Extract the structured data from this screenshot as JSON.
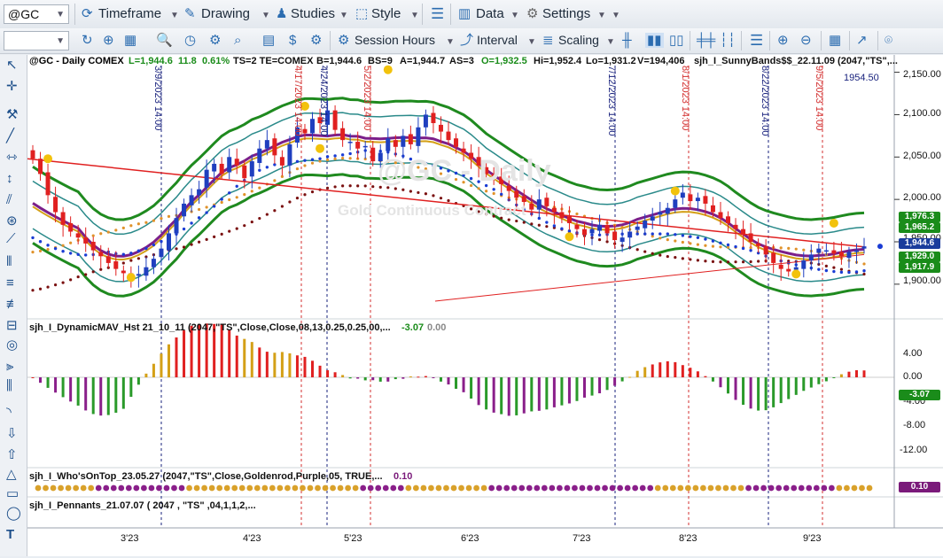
{
  "toolbar1": {
    "symbol": "@GC",
    "timeframe": "Timeframe",
    "drawing": "Drawing",
    "studies": "Studies",
    "style": "Style",
    "data": "Data",
    "settings": "Settings"
  },
  "toolbar2": {
    "session_hours": "Session Hours",
    "interval": "Interval",
    "scaling": "Scaling"
  },
  "chart_header": {
    "symbol_info": "@GC - Daily  COMEX",
    "last": "L=1,944.6",
    "change": "11.8",
    "change_pct": "0.61%",
    "ts_info": "TS=2  TE=COMEX",
    "bid": "B=1,944.6",
    "bs": "BS=9",
    "ask": "A=1,944.7",
    "as": "AS=3",
    "open": "O=1,932.5",
    "high": "Hi=1,952.4",
    "low": "Lo=1,931.2",
    "volume": "V=194,406",
    "study": "sjh_I_SunnyBands$$_22.11.09 (2047,\"TS\",...",
    "cursor_price": "1954.50"
  },
  "watermark": {
    "title": "@GC - Daily",
    "subtitle": "Gold Continuous Contract"
  },
  "panes": {
    "dynamic_mav": {
      "label": "sjh_I_DynamicMAV_Hst 21_10_11 (2047,\"TS\",Close,Close,08,13,0.25,0.25,00,...",
      "v1": "-3.07",
      "v2": "0.00"
    },
    "whos_on_top": {
      "label": "sjh_I_Who'sOnTop_23.05.27 (2047,\"TS\",Close,Goldenrod,Purple,05,  TRUE,...",
      "v1": "0.10"
    },
    "pennants": {
      "label": "sjh_I_Pennants_21.07.07 (  2047 ,  \"TS\" ,04,1,1,2,..."
    }
  },
  "price_axis": [
    "2,150.00",
    "2,100.00",
    "2,050.00",
    "2,000.00",
    "1,950.00",
    "1,900.00"
  ],
  "price_badges": [
    {
      "text": "1,976.3",
      "color": "#1a8c1a"
    },
    {
      "text": "1,965.2",
      "color": "#1a8c1a"
    },
    {
      "text": "1,944.6",
      "color": "#1a3c9c"
    },
    {
      "text": "1,929.0",
      "color": "#1a8c1a"
    },
    {
      "text": "1,917.9",
      "color": "#1a8c1a"
    }
  ],
  "mav_axis": [
    "4.00",
    "0.00",
    "-4.00",
    "-8.00",
    "-12.00"
  ],
  "mav_badge": {
    "text": "-3.07",
    "color": "#1a8c1a"
  },
  "wot_badge": {
    "text": "0.10",
    "color": "#7a1a7a"
  },
  "date_axis": [
    "3'23",
    "4'23",
    "5'23",
    "6'23",
    "7'23",
    "8'23",
    "9'23"
  ],
  "event_lines": [
    {
      "label": "3/9/2023 14:00",
      "color": "#1a237e"
    },
    {
      "label": "4/17/2023 14:00",
      "color": "#d32f2f"
    },
    {
      "label": "4/24/2023 14:00",
      "color": "#1a237e"
    },
    {
      "label": "5/2/2023 14:00",
      "color": "#d32f2f"
    },
    {
      "label": "7/12/2023 14:00",
      "color": "#1a237e"
    },
    {
      "label": "8/1/2023 14:00",
      "color": "#d32f2f"
    },
    {
      "label": "8/22/2023 14:00",
      "color": "#1a237e"
    },
    {
      "label": "9/5/2023 14:00",
      "color": "#d32f2f"
    }
  ],
  "chart_data": {
    "type": "candlestick",
    "symbol": "@GC",
    "interval": "Daily",
    "ylim": [
      1880,
      2160
    ],
    "close": [
      2048,
      2030,
      2005,
      1985,
      1970,
      1962,
      1955,
      1948,
      1940,
      1933,
      1925,
      1918,
      1913,
      1908,
      1912,
      1920,
      1930,
      1942,
      1960,
      1978,
      1995,
      2005,
      2012,
      2035,
      2042,
      2030,
      2050,
      2040,
      2025,
      2045,
      2060,
      2070,
      2052,
      2040,
      2065,
      2085,
      2078,
      2095,
      2090,
      2105,
      2082,
      2070,
      2068,
      2060,
      2063,
      2045,
      2055,
      2072,
      2062,
      2075,
      2065,
      2085,
      2100,
      2090,
      2080,
      2070,
      2062,
      2055,
      2048,
      2040,
      2030,
      2025,
      2018,
      2010,
      2002,
      1997,
      1988,
      2000,
      1992,
      1985,
      1978,
      1972,
      1965,
      1958,
      1965,
      1970,
      1960,
      1952,
      1955,
      1962,
      1968,
      1975,
      1980,
      1985,
      1990,
      2000,
      2008,
      1998,
      2002,
      1995,
      1985,
      1978,
      1972,
      1965,
      1958,
      1950,
      1945,
      1935,
      1925,
      1918,
      1915,
      1920,
      1928,
      1935,
      1942,
      1940,
      1936,
      1933,
      1938,
      1940,
      1944.6
    ]
  }
}
